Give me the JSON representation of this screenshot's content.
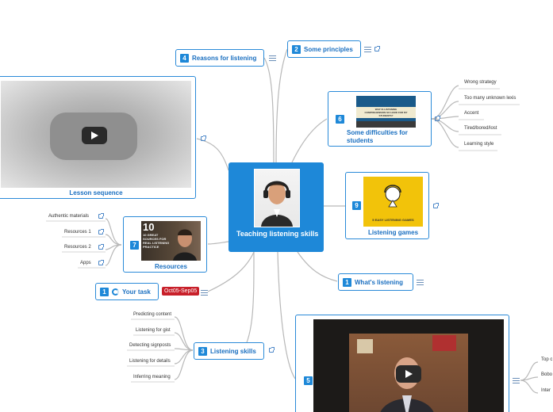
{
  "central": {
    "title": "Teaching listening skills"
  },
  "nodes": {
    "principles": {
      "badge": "2",
      "label": "Some principles"
    },
    "reasons": {
      "badge": "4",
      "label": "Reasons for listening"
    },
    "difficulties": {
      "badge": "6",
      "label": "Some difficulties for students",
      "image_text": "WHY IS LISTENING COMPREHENSION SO HARD FOR MY STUDENTS?"
    },
    "games": {
      "badge": "9",
      "label": "Listening games",
      "image_text": "5 EASY LISTENING GAMES"
    },
    "whats": {
      "badge": "1",
      "label": "What's listening"
    },
    "resources": {
      "badge": "7",
      "label": "Resources",
      "image_text": "10 GREAT SOURCES FOR REAL LISTENING PRACTICE"
    },
    "task": {
      "badge": "1",
      "label": "Your task",
      "date_tag": "Oct05-Sep05"
    },
    "skills": {
      "badge": "3",
      "label": "Listening skills"
    },
    "lesson": {
      "label": "Lesson sequence"
    },
    "video5": {
      "badge": "5"
    }
  },
  "leaves": {
    "difficulties": [
      "Wrong strategy",
      "Too many unknown lexis",
      "Accent",
      "Tired/bored/lost",
      "Learning style"
    ],
    "resources": [
      "Authentic materials",
      "Resources 1",
      "Resources 2",
      "Apps"
    ],
    "skills": [
      "Predicting content",
      "Listening for gist",
      "Detecting signposts",
      "Listening for details",
      "Inferring meaning"
    ],
    "video5": [
      "Top c",
      "Bobo",
      "Inter"
    ]
  },
  "icons": {
    "accent": "#1e88d8",
    "tag": "#c8202a"
  }
}
